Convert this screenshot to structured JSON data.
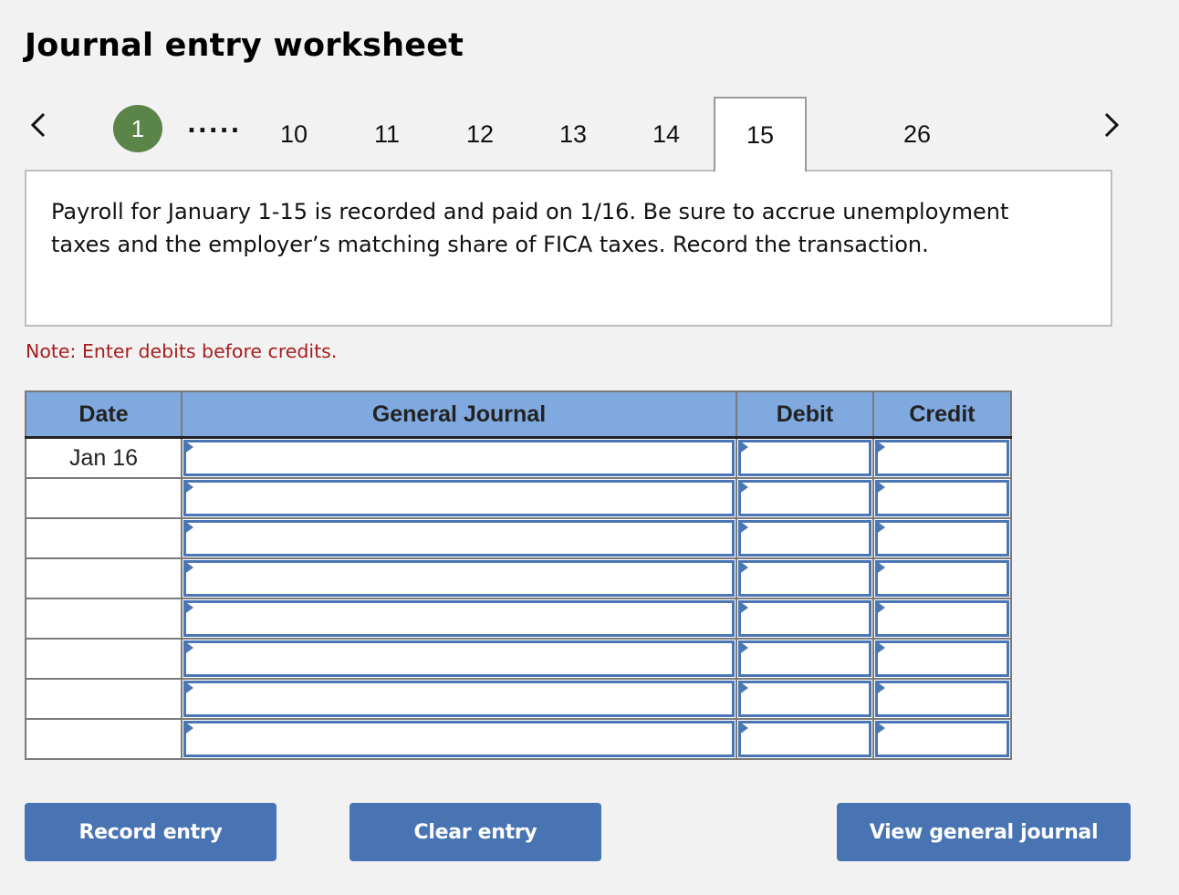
{
  "title": "Journal entry worksheet",
  "navigation": {
    "prev_icon": "chevron-left-icon",
    "next_icon": "chevron-right-icon",
    "current_step": "1",
    "ellipsis": ".....",
    "tabs": [
      "10",
      "11",
      "12",
      "13",
      "14",
      "15",
      "26"
    ],
    "active_tab": "15"
  },
  "question": {
    "text": "Payroll for January 1-15 is recorded and paid on 1/16. Be sure to accrue unemployment taxes and the employer’s matching share of FICA taxes. Record the transaction."
  },
  "note": "Note: Enter debits before credits.",
  "journal": {
    "headers": {
      "date": "Date",
      "general_journal": "General Journal",
      "debit": "Debit",
      "credit": "Credit"
    },
    "rows": [
      {
        "date": "Jan 16",
        "account": "",
        "debit": "",
        "credit": ""
      },
      {
        "date": "",
        "account": "",
        "debit": "",
        "credit": ""
      },
      {
        "date": "",
        "account": "",
        "debit": "",
        "credit": ""
      },
      {
        "date": "",
        "account": "",
        "debit": "",
        "credit": ""
      },
      {
        "date": "",
        "account": "",
        "debit": "",
        "credit": ""
      },
      {
        "date": "",
        "account": "",
        "debit": "",
        "credit": ""
      },
      {
        "date": "",
        "account": "",
        "debit": "",
        "credit": ""
      },
      {
        "date": "",
        "account": "",
        "debit": "",
        "credit": ""
      }
    ]
  },
  "buttons": {
    "record": "Record entry",
    "clear": "Clear entry",
    "view": "View general journal"
  },
  "colors": {
    "background": "#f2f2f2",
    "step_circle": "#5a8448",
    "header_blue": "#80aadf",
    "entry_border": "#4a76b5",
    "button": "#4874b3",
    "note_red": "#a61d1d"
  }
}
